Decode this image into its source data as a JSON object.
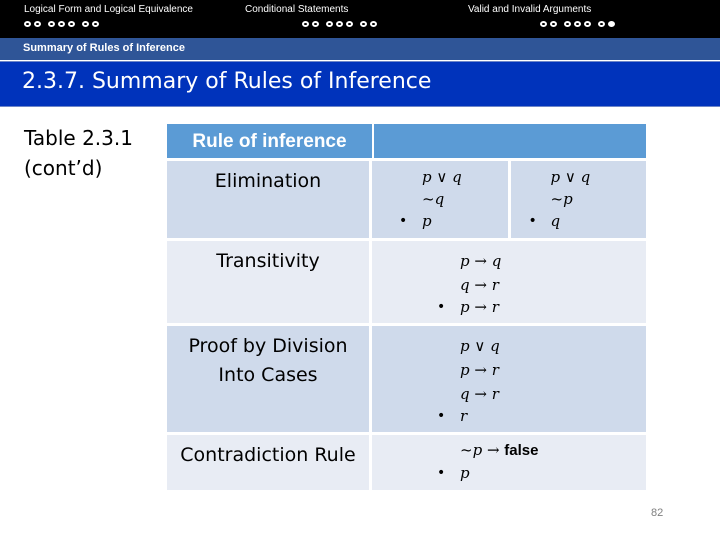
{
  "nav": {
    "sections": [
      {
        "title": "Logical Form and Logical Equivalence",
        "dots": 7,
        "filled": -1
      },
      {
        "title": "Conditional Statements",
        "dots": 7,
        "filled": -1
      },
      {
        "title": "Valid and Invalid Arguments",
        "dots": 7,
        "filled": 6
      }
    ],
    "subsection": "Summary of Rules of Inference"
  },
  "slide": {
    "title": "2.3.7. Summary of Rules of Inference",
    "table_label_line1": "Table 2.3.1",
    "table_label_line2": "(cont’d)",
    "page_number": "82"
  },
  "table": {
    "header": "Rule of inference",
    "rows": [
      {
        "name": "Elimination",
        "forms": [
          {
            "premises": [
              "p ∨ q",
              "~q"
            ],
            "conclusion": "p"
          },
          {
            "premises": [
              "p ∨ q",
              "~p"
            ],
            "conclusion": "q"
          }
        ]
      },
      {
        "name": "Transitivity",
        "forms": [
          {
            "premises": [
              "p → q",
              "q → r"
            ],
            "conclusion": "p → r"
          }
        ]
      },
      {
        "name_line1": "Proof by Division",
        "name_line2": "Into Cases",
        "forms": [
          {
            "premises": [
              "p ∨ q",
              "p → r",
              "q → r"
            ],
            "conclusion": "r"
          }
        ]
      },
      {
        "name": "Contradiction Rule",
        "forms": [
          {
            "premises_prefix": "~p →",
            "premises_bold": "false",
            "conclusion": "p"
          }
        ]
      }
    ],
    "therefore_symbol": "•"
  }
}
